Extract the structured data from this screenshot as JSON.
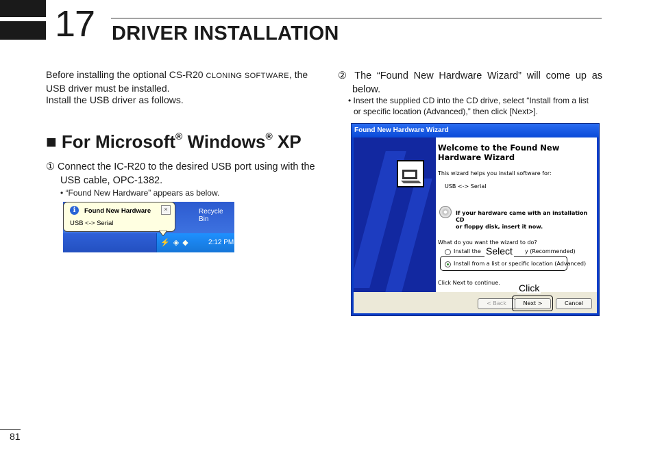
{
  "header": {
    "chapter_number": "17",
    "chapter_title": "DRIVER INSTALLATION"
  },
  "intro": {
    "line1_pre": "Before installing the optional CS-R20",
    "line1_smallcaps": "cloning software",
    "line1_post": ", the",
    "line2": "USB driver must be installed.",
    "line3": "Install the USB driver as follows."
  },
  "section": {
    "heading_pre": "■ For Microsoft",
    "reg1": "®",
    "heading_mid": " Windows",
    "reg2": "®",
    "heading_post": " XP"
  },
  "step1": {
    "marker": "①",
    "line1": "Connect the IC-R20 to the desired USB port using with the",
    "line2": "USB cable, OPC-1382.",
    "note": "• “Found New Hardware” appears as below."
  },
  "taskbar_screenshot": {
    "balloon_title": "Found New Hardware",
    "balloon_body": "USB <-> Serial",
    "close_glyph": "×",
    "desktop_icon_label": "Recycle Bin",
    "tray_icons": "⚡ ◈ ◆",
    "clock": "2:12 PM"
  },
  "step2": {
    "marker": "②",
    "line1": "The “Found New Hardware Wizard” will come up as",
    "line2": "below.",
    "note1": "• Insert the supplied CD into the CD drive, select “Install from a list",
    "note2": "or specific location (Advanced),” then click [Next>]."
  },
  "wizard": {
    "window_title": "Found New Hardware Wizard",
    "heading_line1": "Welcome to the Found New",
    "heading_line2": "Hardware Wizard",
    "intro": "This wizard helps you install software for:",
    "device": "USB <-> Serial",
    "cd_line1": "If your hardware came with an installation CD",
    "cd_line2": "or floppy disk, insert it now.",
    "question": "What do you want the wizard to do?",
    "option1": "Install the",
    "option1_tail": "y (Recommended)",
    "option2": "Install from a list or specific location (Advanced)",
    "continue": "Click Next to continue.",
    "back_button": "< Back",
    "next_button": "Next >",
    "cancel_button": "Cancel",
    "callout_select": "Select",
    "callout_click": "Click"
  },
  "footer": {
    "page_number": "81"
  }
}
